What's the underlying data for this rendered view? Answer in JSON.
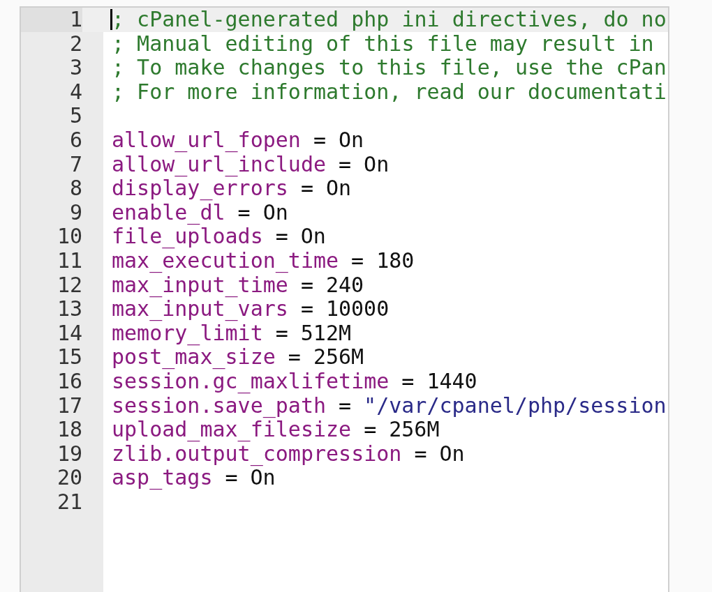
{
  "editor": {
    "lines": [
      {
        "number": "1",
        "kind": "comment",
        "text": "; cPanel-generated php ini directives, do no",
        "active": true,
        "cursor": true
      },
      {
        "number": "2",
        "kind": "comment",
        "text": "; Manual editing of this file may result in",
        "active": false,
        "cursor": false
      },
      {
        "number": "3",
        "kind": "comment",
        "text": "; To make changes to this file, use the cPan",
        "active": false,
        "cursor": false
      },
      {
        "number": "4",
        "kind": "comment",
        "text": "; For more information, read our documentati",
        "active": false,
        "cursor": false
      },
      {
        "number": "5",
        "kind": "blank",
        "active": false,
        "cursor": false
      },
      {
        "number": "6",
        "kind": "setting",
        "key": "allow_url_fopen",
        "operator": "=",
        "value": "On",
        "active": false,
        "cursor": false
      },
      {
        "number": "7",
        "kind": "setting",
        "key": "allow_url_include",
        "operator": "=",
        "value": "On",
        "active": false,
        "cursor": false
      },
      {
        "number": "8",
        "kind": "setting",
        "key": "display_errors",
        "operator": "=",
        "value": "On",
        "active": false,
        "cursor": false
      },
      {
        "number": "9",
        "kind": "setting",
        "key": "enable_dl",
        "operator": "=",
        "value": "On",
        "active": false,
        "cursor": false
      },
      {
        "number": "10",
        "kind": "setting",
        "key": "file_uploads",
        "operator": "=",
        "value": "On",
        "active": false,
        "cursor": false
      },
      {
        "number": "11",
        "kind": "setting",
        "key": "max_execution_time",
        "operator": "=",
        "value": "180",
        "active": false,
        "cursor": false
      },
      {
        "number": "12",
        "kind": "setting",
        "key": "max_input_time",
        "operator": "=",
        "value": "240",
        "active": false,
        "cursor": false
      },
      {
        "number": "13",
        "kind": "setting",
        "key": "max_input_vars",
        "operator": "=",
        "value": "10000",
        "active": false,
        "cursor": false
      },
      {
        "number": "14",
        "kind": "setting",
        "key": "memory_limit",
        "operator": "=",
        "value": "512M",
        "active": false,
        "cursor": false
      },
      {
        "number": "15",
        "kind": "setting",
        "key": "post_max_size",
        "operator": "=",
        "value": "256M",
        "active": false,
        "cursor": false
      },
      {
        "number": "16",
        "kind": "setting",
        "key": "session.gc_maxlifetime",
        "operator": "=",
        "value": "1440",
        "active": false,
        "cursor": false
      },
      {
        "number": "17",
        "kind": "string_setting",
        "key": "session.save_path",
        "operator": "=",
        "value": "\"/var/cpanel/php/session",
        "active": false,
        "cursor": false
      },
      {
        "number": "18",
        "kind": "setting",
        "key": "upload_max_filesize",
        "operator": "=",
        "value": "256M",
        "active": false,
        "cursor": false
      },
      {
        "number": "19",
        "kind": "setting",
        "key": "zlib.output_compression",
        "operator": "=",
        "value": "On",
        "active": false,
        "cursor": false
      },
      {
        "number": "20",
        "kind": "setting",
        "key": "asp_tags",
        "operator": "=",
        "value": "On",
        "active": false,
        "cursor": false
      },
      {
        "number": "21",
        "kind": "blank",
        "active": false,
        "cursor": false
      }
    ]
  }
}
